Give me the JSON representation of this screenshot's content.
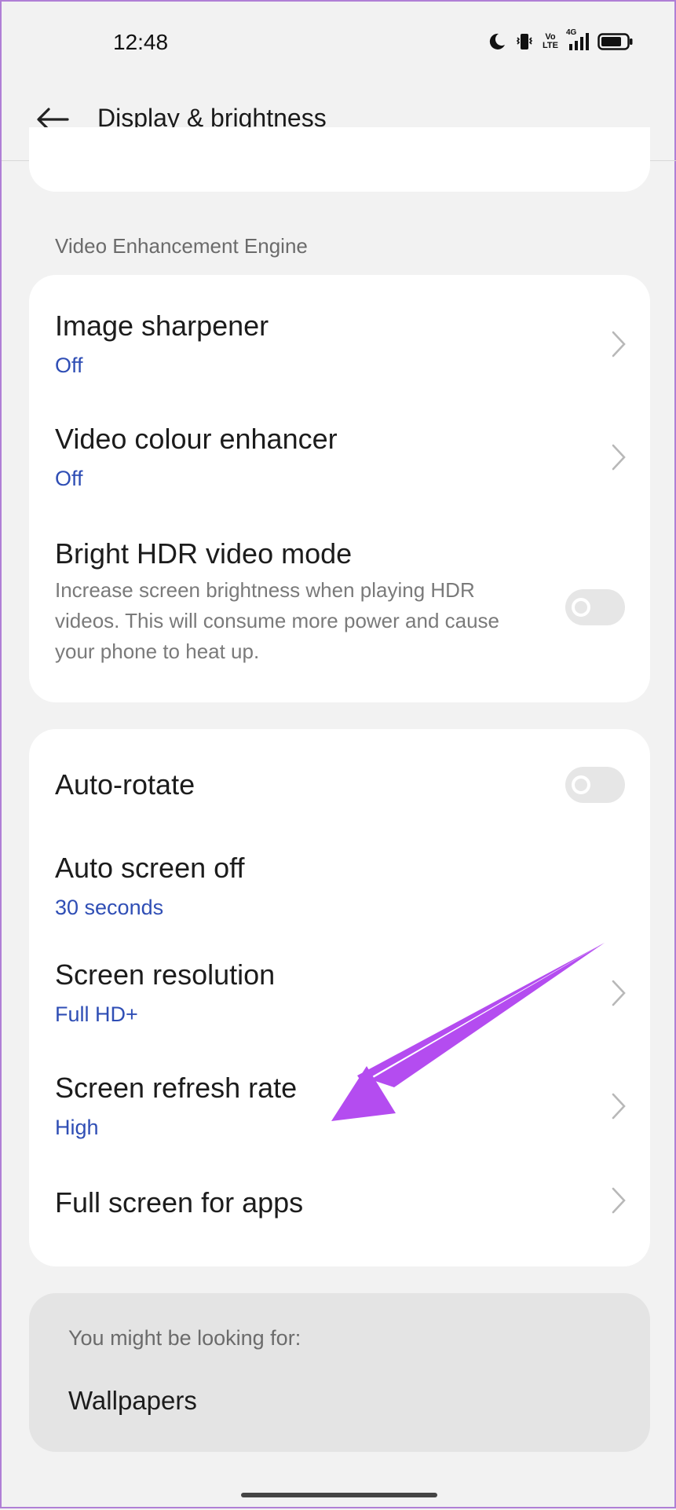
{
  "status_bar": {
    "time": "12:48",
    "icons": [
      "moon-icon",
      "vibrate-icon",
      "volte-icon",
      "signal-4g-icon",
      "battery-icon"
    ],
    "volte_text": "Vo LTE",
    "network_text": "4G"
  },
  "header": {
    "title": "Display & brightness",
    "back_icon": "arrow-left-icon"
  },
  "video_section": {
    "header": "Video Enhancement Engine",
    "items": [
      {
        "title": "Image sharpener",
        "value": "Off"
      },
      {
        "title": "Video colour enhancer",
        "value": "Off"
      },
      {
        "title": "Bright HDR video mode",
        "description": "Increase screen brightness when playing HDR videos. This will consume more power and cause your phone to heat up.",
        "toggle": false
      }
    ]
  },
  "display_section": {
    "items": [
      {
        "title": "Auto-rotate",
        "toggle": false
      },
      {
        "title": "Auto screen off",
        "value": "30 seconds"
      },
      {
        "title": "Screen resolution",
        "value": "Full HD+"
      },
      {
        "title": "Screen refresh rate",
        "value": "High"
      },
      {
        "title": "Full screen for apps"
      }
    ]
  },
  "suggestions": {
    "header": "You might be looking for:",
    "items": [
      "Wallpapers"
    ]
  },
  "colors": {
    "accent_value": "#2f4eb5",
    "annotation_arrow": "#b44cf0",
    "background": "#f2f2f2",
    "card": "#ffffff"
  }
}
